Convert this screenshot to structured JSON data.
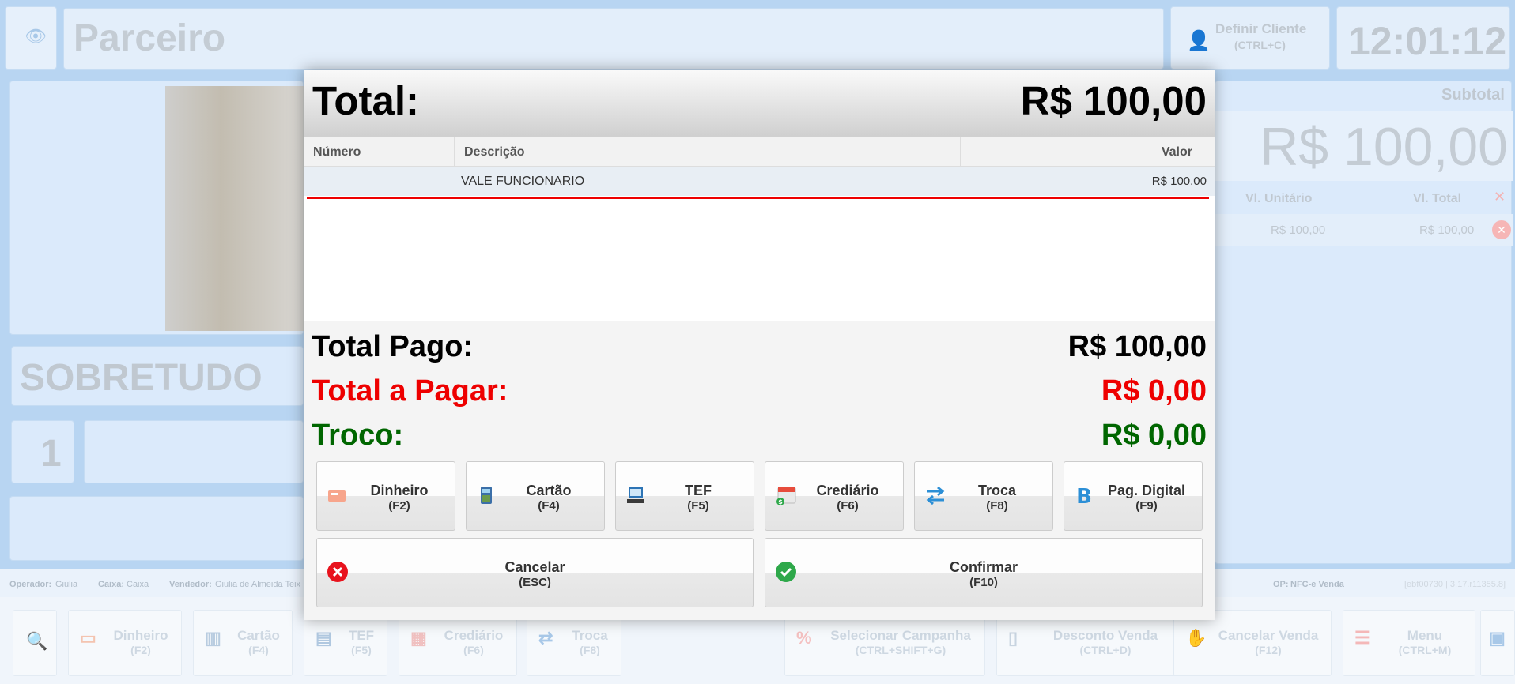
{
  "background": {
    "partner_label": "Parceiro",
    "define_client": {
      "label": "Definir Cliente",
      "shortcut": "(CTRL+C)"
    },
    "clock": "12:01:12",
    "subtotal_label": "Subtotal",
    "subtotal_value": "R$ 100,00",
    "columns": [
      "Vl. Unitário",
      "Vl. Total"
    ],
    "item_row": {
      "unit": "R$ 100,00",
      "total": "R$ 100,00"
    },
    "product_name": "SOBRETUDO",
    "quantity": "1",
    "status": {
      "operator_label": "Operador:",
      "operator": "Giulia",
      "cashier_label": "Caixa:",
      "cashier": "Caixa",
      "seller_label": "Vendedor:",
      "seller": "Giulia de Almeida Teix",
      "op_label": "OP:",
      "op": "NFC-e Venda",
      "version": "[ebf00730 | 3.17.r11355.8]"
    },
    "bottom_buttons": [
      {
        "label": "Dinheiro",
        "shortcut": "(F2)"
      },
      {
        "label": "Cartão",
        "shortcut": "(F4)"
      },
      {
        "label": "TEF",
        "shortcut": "(F5)"
      },
      {
        "label": "Crediário",
        "shortcut": "(F6)"
      },
      {
        "label": "Troca",
        "shortcut": "(F8)"
      },
      {
        "label": "Selecionar Campanha",
        "shortcut": "(CTRL+SHIFT+G)"
      },
      {
        "label": "Desconto Venda",
        "shortcut": "(CTRL+D)"
      },
      {
        "label": "Cancelar Venda",
        "shortcut": "(F12)"
      },
      {
        "label": "Menu",
        "shortcut": "(CTRL+M)"
      }
    ]
  },
  "modal": {
    "title": "Total:",
    "total": "R$ 100,00",
    "table": {
      "headers": [
        "Número",
        "Descrição",
        "Valor"
      ],
      "rows": [
        {
          "numero": "",
          "descricao": "VALE FUNCIONARIO",
          "valor": "R$ 100,00"
        }
      ]
    },
    "total_pago_label": "Total Pago:",
    "total_pago": "R$ 100,00",
    "total_a_pagar_label": "Total a Pagar:",
    "total_a_pagar": "R$ 0,00",
    "troco_label": "Troco:",
    "troco": "R$ 0,00",
    "payment_buttons": [
      {
        "label": "Dinheiro",
        "shortcut": "(F2)",
        "icon": "cash-icon"
      },
      {
        "label": "Cartão",
        "shortcut": "(F4)",
        "icon": "card-machine-icon"
      },
      {
        "label": "TEF",
        "shortcut": "(F5)",
        "icon": "tef-terminal-icon"
      },
      {
        "label": "Crediário",
        "shortcut": "(F6)",
        "icon": "calendar-credit-icon"
      },
      {
        "label": "Troca",
        "shortcut": "(F8)",
        "icon": "exchange-arrows-icon"
      },
      {
        "label": "Pag. Digital",
        "shortcut": "(F9)",
        "icon": "bitcoin-icon"
      }
    ],
    "cancel": {
      "label": "Cancelar",
      "shortcut": "(ESC)"
    },
    "confirm": {
      "label": "Confirmar",
      "shortcut": "(F10)"
    }
  },
  "colors": {
    "red": "#ee0000",
    "green": "#006600",
    "cancel_icon": "#e8131d",
    "confirm_icon": "#2ea84a"
  }
}
